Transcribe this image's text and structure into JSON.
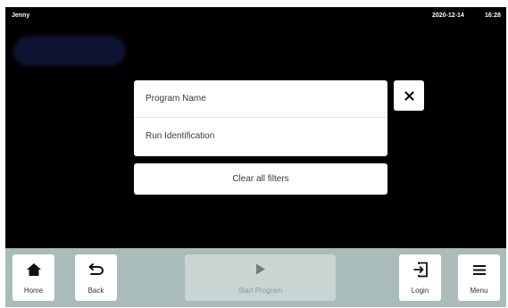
{
  "status_bar": {
    "user": "Jenny",
    "date": "2020-12-14",
    "time": "16:28"
  },
  "filter_panel": {
    "items": [
      {
        "label": "Program Name"
      },
      {
        "label": "Run Identification"
      }
    ],
    "clear_label": "Clear all filters",
    "close_icon": "close-icon"
  },
  "bottom_nav": {
    "home_label": "Home",
    "back_label": "Back",
    "start_label": "Start Program",
    "login_label": "Login",
    "menu_label": "Menu",
    "start_enabled": false
  },
  "colors": {
    "background": "#000000",
    "bottom_bar": "#a9bcb9",
    "disabled_button": "#c9d5d3",
    "button": "#ffffff"
  }
}
